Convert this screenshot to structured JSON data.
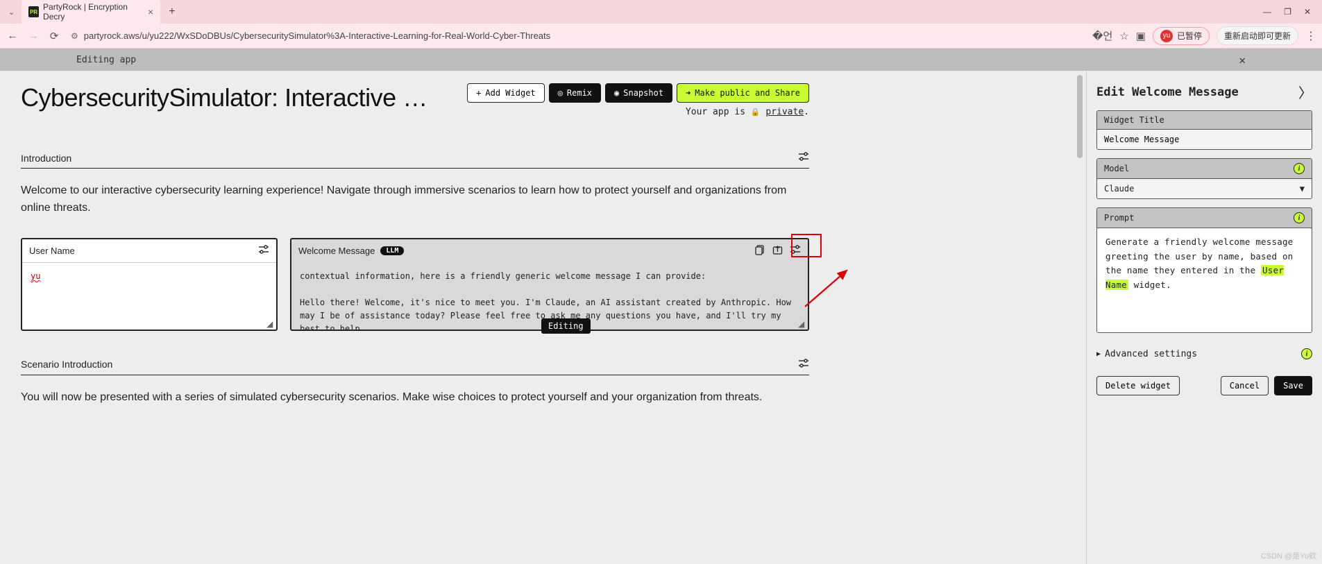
{
  "browser": {
    "tab_title": "PartyRock | Encryption Decry",
    "favicon": "PR",
    "url": "partyrock.aws/u/yu222/WxSDoDBUs/CybersecuritySimulator%3A-Interactive-Learning-for-Real-World-Cyber-Threats",
    "profile_label": "已暂停",
    "profile_initials": "yu",
    "update_label": "重新启动即可更新"
  },
  "banner": {
    "text": "Editing app"
  },
  "header": {
    "title": "CybersecuritySimulator: Interactive …",
    "add_widget": "Add Widget",
    "remix": "Remix",
    "snapshot": "Snapshot",
    "publish": "Make public and Share",
    "status_prefix": "Your app is ",
    "status_link": "private",
    "status_suffix": "."
  },
  "sections": {
    "intro_title": "Introduction",
    "intro_body": "Welcome to our interactive cybersecurity learning experience! Navigate through immersive scenarios to learn how to protect yourself and organizations from online threats.",
    "scenario_title": "Scenario Introduction",
    "scenario_body": "You will now be presented with a series of simulated cybersecurity scenarios. Make wise choices to protect yourself and your organization from threats."
  },
  "user_card": {
    "title": "User Name",
    "value": "yu"
  },
  "msg_card": {
    "title": "Welcome Message",
    "badge": "LLM",
    "body_line1": "contextual information, here is a friendly generic welcome message I can provide:",
    "body_line2": "Hello there! Welcome, it's nice to meet you. I'm Claude, an AI assistant created by Anthropic. How may I be of assistance today? Please feel free to ask me any questions you have, and I'll try my best to help."
  },
  "tooltip": "Editing",
  "panel": {
    "title": "Edit Welcome Message",
    "widget_title_label": "Widget Title",
    "widget_title_value": "Welcome Message",
    "model_label": "Model",
    "model_value": "Claude",
    "prompt_label": "Prompt",
    "prompt_pre": "Generate a friendly welcome message greeting the user by name, based on the name they entered in the ",
    "prompt_hl": "User Name",
    "prompt_post": " widget.",
    "advanced": "Advanced settings",
    "delete": "Delete widget",
    "cancel": "Cancel",
    "save": "Save"
  },
  "watermark": "CSDN @是Yu欸"
}
